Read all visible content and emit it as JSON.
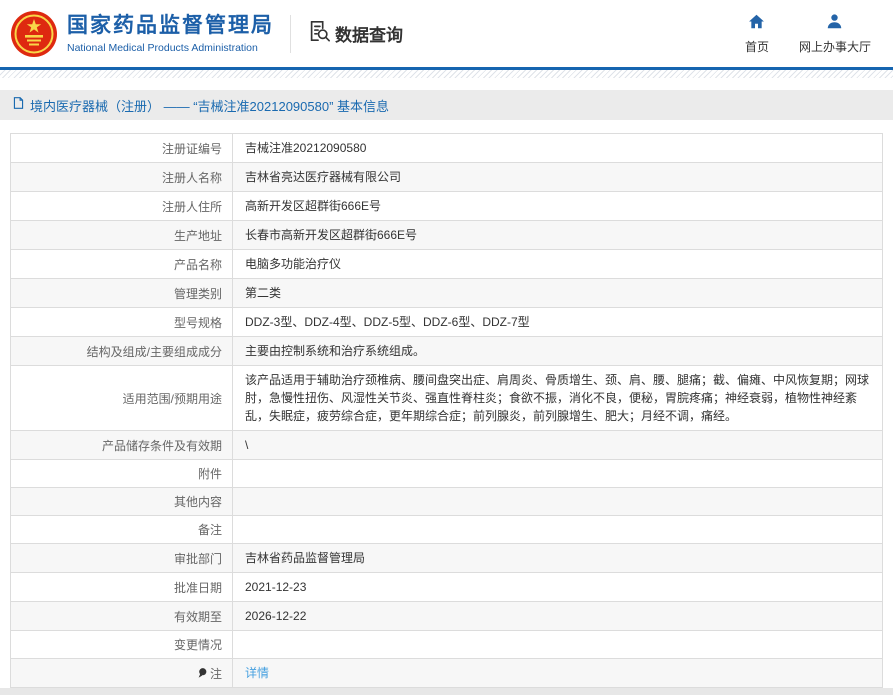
{
  "header": {
    "org_name_cn": "国家药品监督管理局",
    "org_name_en": "National Medical Products Administration",
    "section_title": "数据查询",
    "nav": [
      {
        "label": "首页",
        "icon": "home-icon"
      },
      {
        "label": "网上办事大厅",
        "icon": "user-icon"
      }
    ]
  },
  "breadcrumb": {
    "text": "境内医疗器械（注册） —— “吉械注准20212090580” 基本信息"
  },
  "table": {
    "rows": [
      {
        "label": "注册证编号",
        "value": "吉械注准20212090580"
      },
      {
        "label": "注册人名称",
        "value": "吉林省亮达医疗器械有限公司"
      },
      {
        "label": "注册人住所",
        "value": "高新开发区超群街666E号"
      },
      {
        "label": "生产地址",
        "value": "长春市高新开发区超群街666E号"
      },
      {
        "label": "产品名称",
        "value": "电脑多功能治疗仪"
      },
      {
        "label": "管理类别",
        "value": "第二类"
      },
      {
        "label": "型号规格",
        "value": "DDZ-3型、DDZ-4型、DDZ-5型、DDZ-6型、DDZ-7型"
      },
      {
        "label": "结构及组成/主要组成成分",
        "value": "主要由控制系统和治疗系统组成。"
      },
      {
        "label": "适用范围/预期用途",
        "value": "该产品适用于辅助治疗颈椎病、腰间盘突出症、肩周炎、骨质增生、颈、肩、腰、腿痛；截、偏瘫、中风恢复期；网球肘，急慢性扭伤、风湿性关节炎、强直性脊柱炎；食欲不振，消化不良，便秘，胃脘疼痛；神经衰弱，植物性神经紊乱，失眠症，疲劳综合症，更年期综合症；前列腺炎，前列腺增生、肥大；月经不调，痛经。"
      },
      {
        "label": "产品储存条件及有效期",
        "value": "\\"
      },
      {
        "label": "附件",
        "value": ""
      },
      {
        "label": "其他内容",
        "value": ""
      },
      {
        "label": "备注",
        "value": ""
      },
      {
        "label": "审批部门",
        "value": "吉林省药品监督管理局"
      },
      {
        "label": "批准日期",
        "value": "2021-12-23"
      },
      {
        "label": "有效期至",
        "value": "2026-12-22"
      },
      {
        "label": "变更情况",
        "value": ""
      },
      {
        "label": "注",
        "value": "详情",
        "link": true,
        "label_icon": "note-pin-icon"
      }
    ]
  },
  "colors": {
    "brand_blue": "#1c5fa8",
    "header_rule_blue": "#1565b0",
    "breadcrumb_bg": "#ebebeb",
    "breadcrumb_text": "#1a6ab0",
    "row_alt_bg": "#f7f7f7",
    "table_border": "#dcdcdc",
    "link_blue": "#46a0e0",
    "emblem_red": "#de2910",
    "emblem_gold": "#f9d648"
  }
}
